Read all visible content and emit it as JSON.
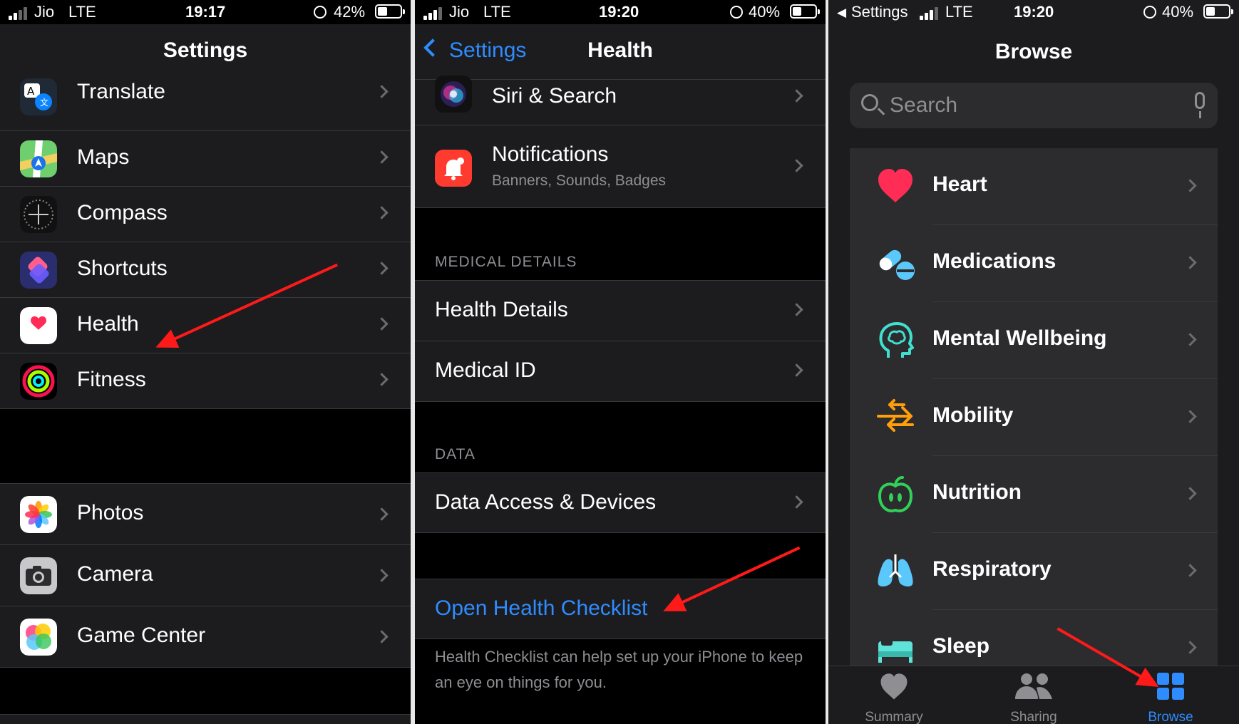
{
  "panel1": {
    "status": {
      "carrier": "Jio",
      "network": "LTE",
      "time": "19:17",
      "battery": "42%",
      "battery_level": 0.42
    },
    "title": "Settings",
    "group1": [
      "Translate",
      "Maps",
      "Compass",
      "Shortcuts",
      "Health",
      "Fitness"
    ],
    "group2": [
      "Photos",
      "Camera",
      "Game Center"
    ]
  },
  "panel2": {
    "status": {
      "carrier": "Jio",
      "network": "LTE",
      "time": "19:20",
      "battery": "40%",
      "battery_level": 0.4
    },
    "back_label": "Settings",
    "title": "Health",
    "siri_label": "Siri & Search",
    "notifications_label": "Notifications",
    "notifications_sub": "Banners, Sounds, Badges",
    "medical_header": "MEDICAL DETAILS",
    "health_details": "Health Details",
    "medical_id": "Medical ID",
    "data_header": "DATA",
    "data_access": "Data Access & Devices",
    "checklist_link": "Open Health Checklist",
    "checklist_footer": "Health Checklist can help set up your iPhone to keep an eye on things for you."
  },
  "panel3": {
    "status": {
      "back": "Settings",
      "network": "LTE",
      "time": "19:20",
      "battery": "40%",
      "battery_level": 0.4
    },
    "title": "Browse",
    "search_placeholder": "Search",
    "categories": [
      "Heart",
      "Medications",
      "Mental Wellbeing",
      "Mobility",
      "Nutrition",
      "Respiratory",
      "Sleep"
    ],
    "tabs": [
      "Summary",
      "Sharing",
      "Browse"
    ]
  },
  "colors": {
    "link": "#2f8cff",
    "annotation": "#ff1a1a"
  }
}
